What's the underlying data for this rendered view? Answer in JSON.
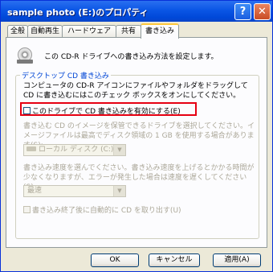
{
  "window": {
    "title": "sample photo (E:)のプロパティ",
    "help_label": "?",
    "close_label": "✕"
  },
  "tabs": [
    {
      "label": "全般"
    },
    {
      "label": "自動再生"
    },
    {
      "label": "ハードウェア"
    },
    {
      "label": "共有"
    },
    {
      "label": "書き込み"
    }
  ],
  "intro_text": "この CD-R ドライブへの書き込み方法を設定します。",
  "group": {
    "label": "デスクトップ CD 書き込み",
    "description": "コンピュータの CD-R アイコンにファイルやフォルダをドラッグして CD に書き込むにはこのチェック ボックスをオンにしてください。",
    "enable_checkbox_label": "このドライブで CD 書き込みを有効にする(E)",
    "image_drive_text": "書き込む CD のイメージを保管できるドライブを選択してください。イメージファイルは最高でディスク領域の 1 GB を使用する場合があります(S):",
    "drive_select_value": "ローカル ディスク (C:)",
    "speed_text": "書き込み速度を選んでください。書き込み速度を上げるとかかる時間が少なくなりますが、エラーが発生した場合は速度を遅くしてください(S):",
    "speed_select_value": "最速",
    "eject_checkbox_label": "書き込み終了後に自動的に CD を取り出す(U)"
  },
  "buttons": {
    "ok": "OK",
    "cancel": "キャンセル",
    "apply": "適用(A)"
  }
}
